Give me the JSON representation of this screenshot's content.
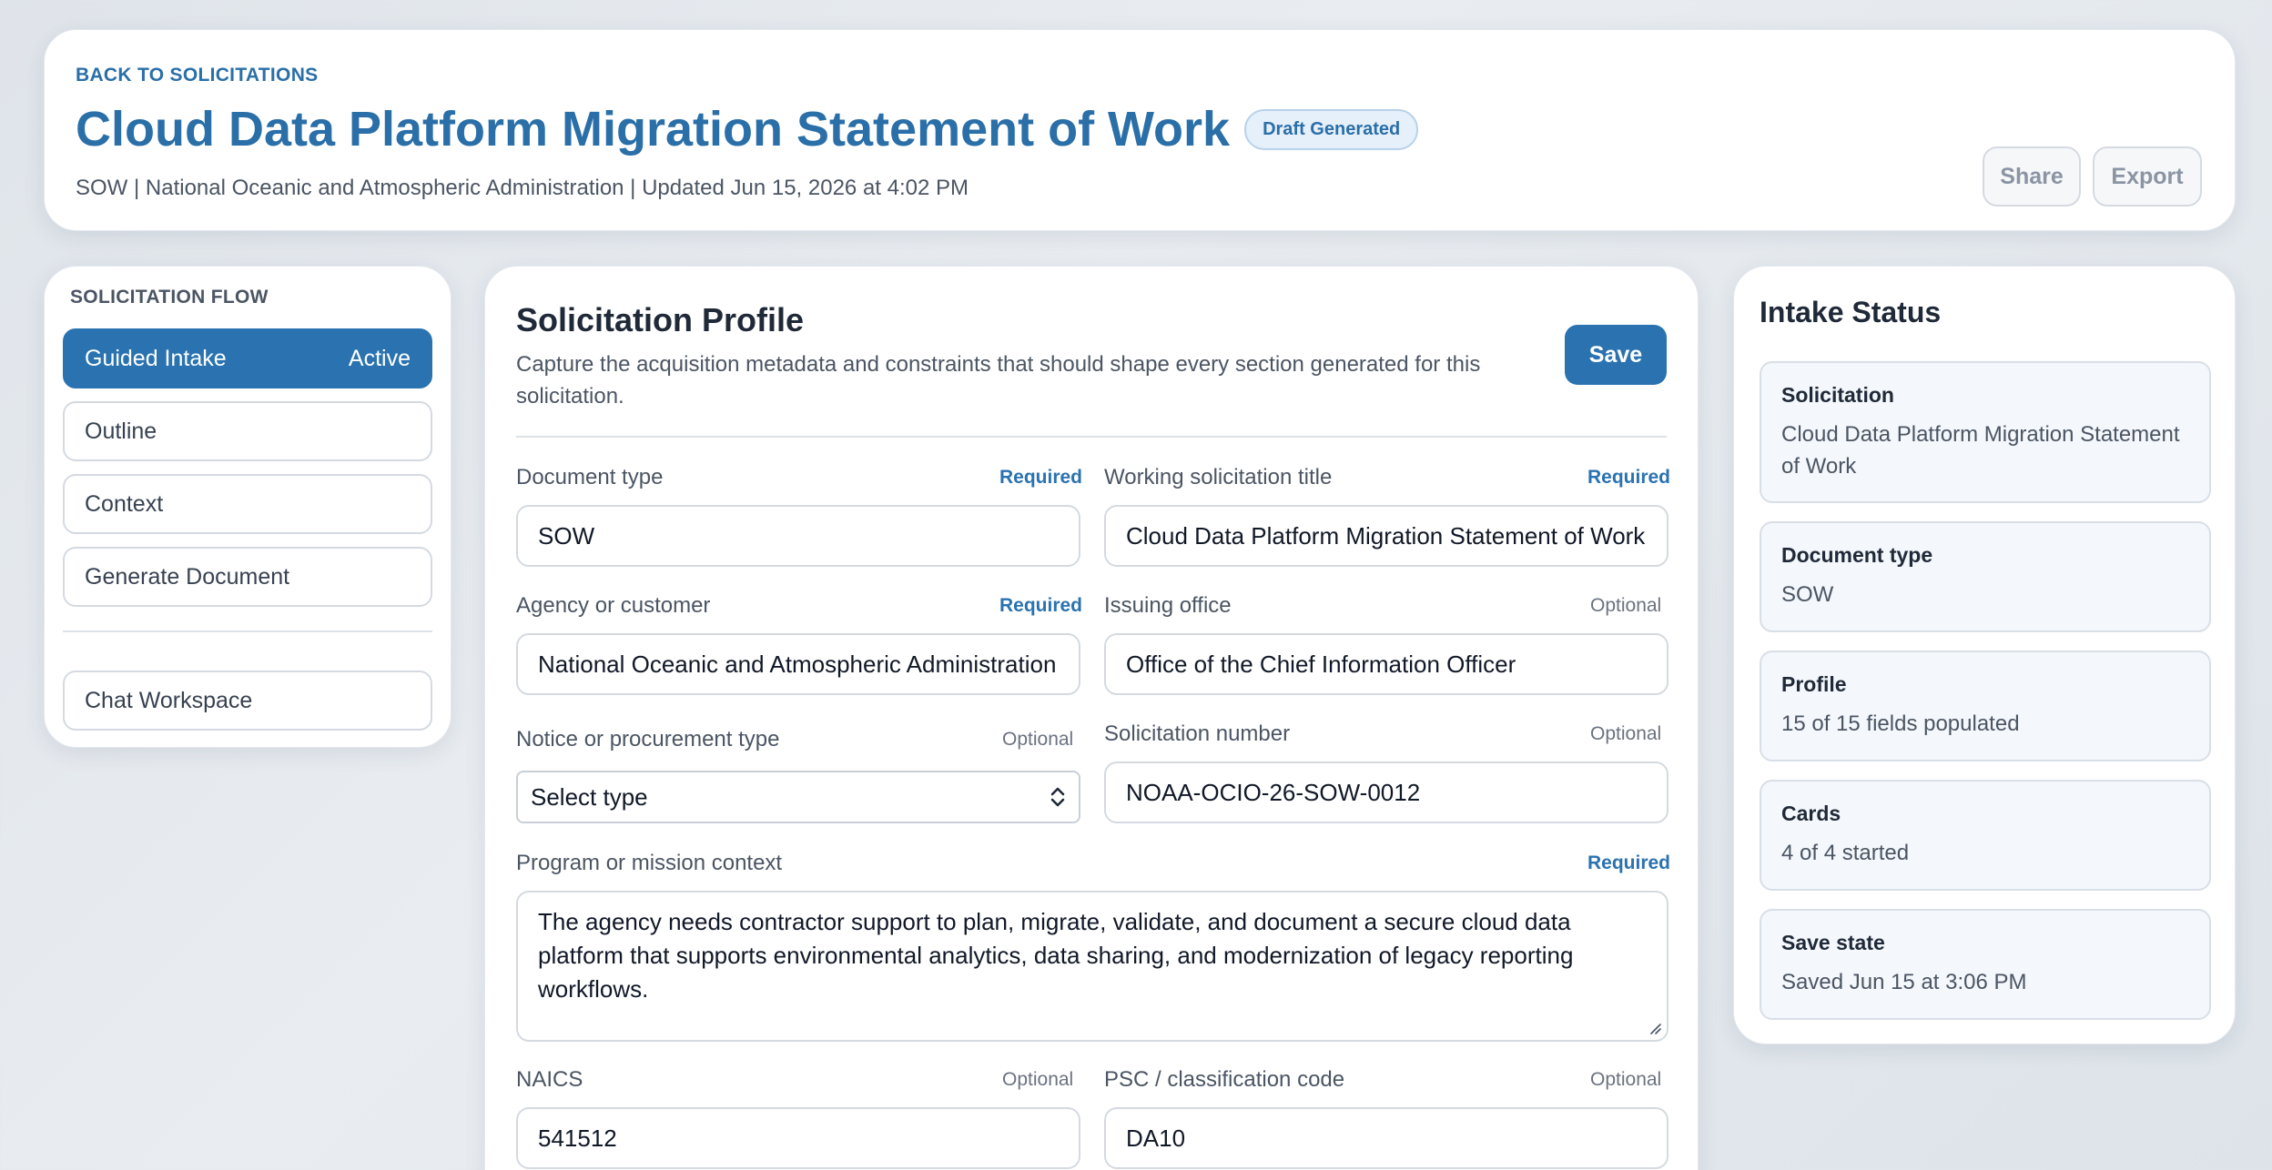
{
  "header": {
    "back_link": "BACK TO SOLICITATIONS",
    "title": "Cloud Data Platform Migration Statement of Work",
    "badge": "Draft Generated",
    "subtitle": "SOW | National Oceanic and Atmospheric Administration | Updated Jun 15, 2026 at 4:02 PM",
    "share_label": "Share",
    "export_label": "Export"
  },
  "sidebar": {
    "section_label": "SOLICITATION FLOW",
    "items": [
      {
        "label": "Guided Intake",
        "status": "Active"
      },
      {
        "label": "Outline"
      },
      {
        "label": "Context"
      },
      {
        "label": "Generate Document"
      }
    ],
    "chat_label": "Chat Workspace"
  },
  "main": {
    "title": "Solicitation Profile",
    "description": "Capture the acquisition metadata and constraints that should shape every section generated for this solicitation.",
    "save_label": "Save",
    "required_label": "Required",
    "optional_label": "Optional",
    "fields": {
      "document_type": {
        "label": "Document type",
        "value": "SOW"
      },
      "working_title": {
        "label": "Working solicitation title",
        "value": "Cloud Data Platform Migration Statement of Work"
      },
      "agency": {
        "label": "Agency or customer",
        "value": "National Oceanic and Atmospheric Administration"
      },
      "issuing_office": {
        "label": "Issuing office",
        "value": "Office of the Chief Information Officer"
      },
      "notice_type": {
        "label": "Notice or procurement type",
        "value": "Select type"
      },
      "solicitation_number": {
        "label": "Solicitation number",
        "value": "NOAA-OCIO-26-SOW-0012"
      },
      "program_context": {
        "label": "Program or mission context",
        "value": "The agency needs contractor support to plan, migrate, validate, and document a secure cloud data platform that supports environmental analytics, data sharing, and modernization of legacy reporting workflows."
      },
      "naics": {
        "label": "NAICS",
        "value": "541512"
      },
      "psc": {
        "label": "PSC / classification code",
        "value": "DA10"
      }
    }
  },
  "status": {
    "title": "Intake Status",
    "cards": [
      {
        "title": "Solicitation",
        "value": "Cloud Data Platform Migration Statement of Work"
      },
      {
        "title": "Document type",
        "value": "SOW"
      },
      {
        "title": "Profile",
        "value": "15 of 15 fields populated"
      },
      {
        "title": "Cards",
        "value": "4 of 4 started"
      },
      {
        "title": "Save state",
        "value": "Saved Jun 15 at 3:06 PM"
      }
    ]
  },
  "colors": {
    "accent": "#2a73b0",
    "title": "#2a6fa8",
    "background": "#e4e8ed"
  }
}
